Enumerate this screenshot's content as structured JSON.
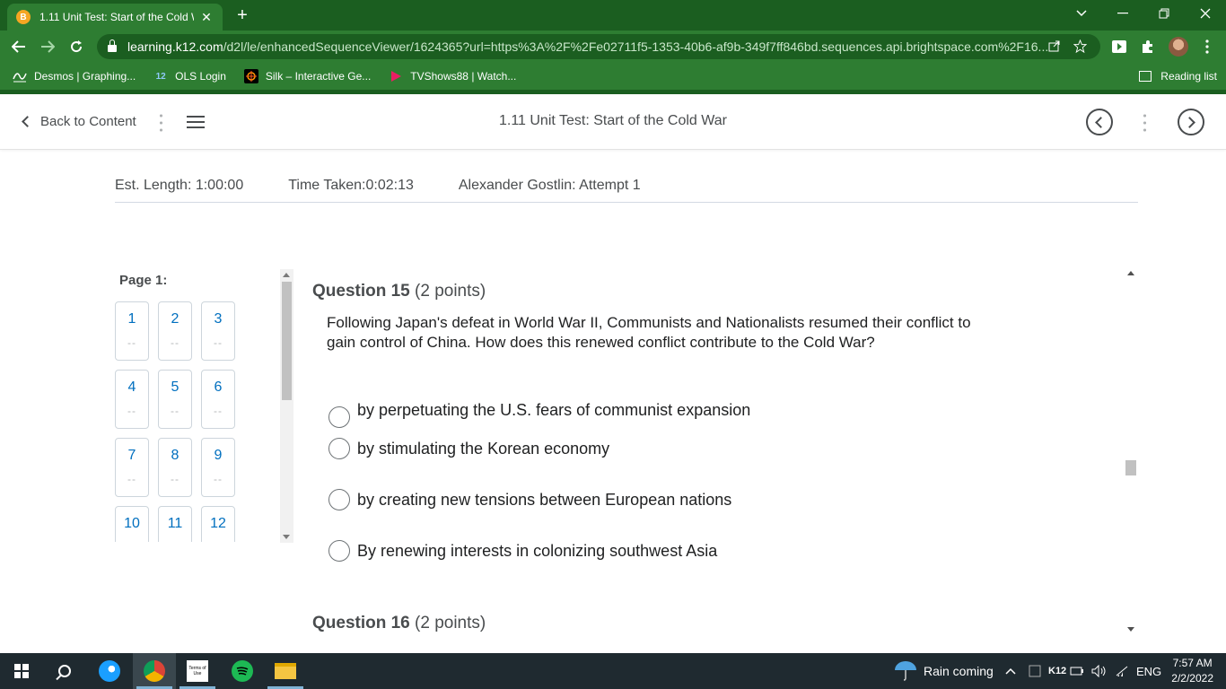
{
  "browser": {
    "tab_title": "1.11 Unit Test: Start of the Cold W",
    "tab_favicon_letter": "B",
    "tab_close": "✕",
    "new_tab": "+",
    "url_host": "learning.k12.com",
    "url_rest": "/d2l/le/enhancedSequenceViewer/1624365?url=https%3A%2F%2Fe02711f5-1353-40b6-af9b-349f7ff846bd.sequences.api.brightspace.com%2F16...",
    "bookmarks": [
      {
        "label": "Desmos | Graphing...",
        "icon": "desmos-icon"
      },
      {
        "label": "OLS Login",
        "icon": "k12-icon",
        "icon_text": "12"
      },
      {
        "label": "Silk – Interactive Ge...",
        "icon": "silk-icon"
      },
      {
        "label": "TVShows88 | Watch...",
        "icon": "play-icon"
      }
    ],
    "reading_list": "Reading list"
  },
  "header": {
    "back_label": "Back to Content",
    "title": "1.11 Unit Test: Start of the Cold War"
  },
  "info": {
    "est_length": "Est. Length: 1:00:00",
    "time_taken": "Time Taken:0:02:13",
    "attempt": "Alexander Gostlin: Attempt 1"
  },
  "nav": {
    "page_label": "Page 1:",
    "questions": [
      {
        "n": "1",
        "status": "--"
      },
      {
        "n": "2",
        "status": "--"
      },
      {
        "n": "3",
        "status": "--"
      },
      {
        "n": "4",
        "status": "--"
      },
      {
        "n": "5",
        "status": "--"
      },
      {
        "n": "6",
        "status": "--"
      },
      {
        "n": "7",
        "status": "--"
      },
      {
        "n": "8",
        "status": "--"
      },
      {
        "n": "9",
        "status": "--"
      },
      {
        "n": "10",
        "status": "--"
      },
      {
        "n": "11",
        "status": "--"
      },
      {
        "n": "12",
        "status": "--"
      }
    ]
  },
  "question15": {
    "heading": "Question 15",
    "points": "(2 points)",
    "text": "Following Japan's defeat in World War II, Communists and Nationalists resumed their conflict to gain control of China. How does this renewed conflict contribute to the Cold War?",
    "options": [
      "by perpetuating the U.S. fears of communist expansion",
      "by stimulating the Korean economy",
      "by creating new tensions between European nations",
      "By renewing interests in colonizing southwest Asia"
    ]
  },
  "question16": {
    "heading": "Question 16",
    "points": "(2 points)"
  },
  "taskbar": {
    "weather": "Rain coming",
    "lang": "ENG",
    "k12": "K12",
    "time": "7:57 AM",
    "date": "2/2/2022",
    "terms_icon_text": "Terms of Use"
  },
  "colors": {
    "chrome_green": "#2e7d32",
    "chrome_dark_green": "#1b5e20",
    "link_blue": "#006fbf",
    "taskbar": "#1f2a30"
  }
}
